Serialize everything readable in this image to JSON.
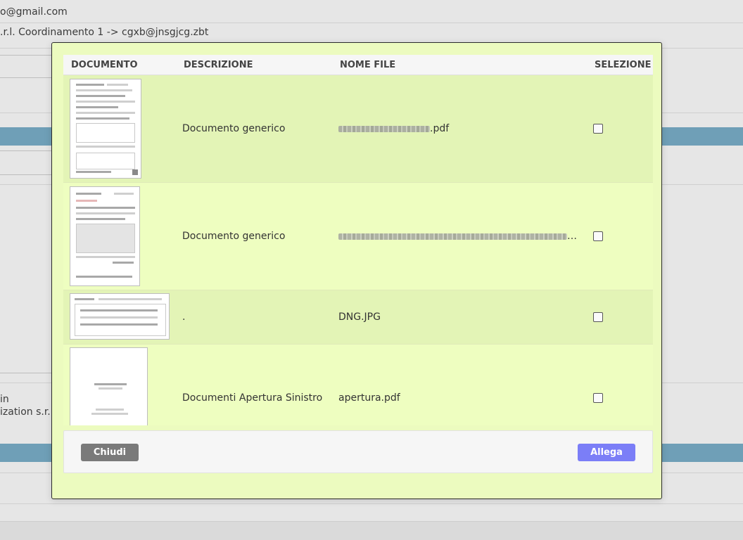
{
  "background": {
    "email_line": "o@gmail.com",
    "coord_line": ".r.l. Coordinamento 1 -> cgxb@jnsgjcg.zbt",
    "side_text_1": "in",
    "side_text_2": "ization s.r.l."
  },
  "modal": {
    "headers": {
      "documento": "DOCUMENTO",
      "descrizione": "DESCRIZIONE",
      "nome_file": "NOME FILE",
      "selezione": "SELEZIONE"
    },
    "rows": [
      {
        "descrizione": "Documento generico",
        "nome_file_suffix": ".pdf",
        "selected": false
      },
      {
        "descrizione": "Documento generico",
        "nome_file_suffix": "_...",
        "selected": false
      },
      {
        "descrizione": ".",
        "nome_file": "DNG.JPG",
        "selected": false
      },
      {
        "descrizione": "Documenti Apertura Sinistro",
        "nome_file": "apertura.pdf",
        "selected": false
      }
    ],
    "buttons": {
      "close": "Chiudi",
      "attach": "Allega"
    },
    "colors": {
      "modal_bg": "#ecfbbf",
      "attach_button": "#7b7ef7",
      "close_button": "#7a7a7a",
      "band": "#6f9fb7"
    }
  }
}
